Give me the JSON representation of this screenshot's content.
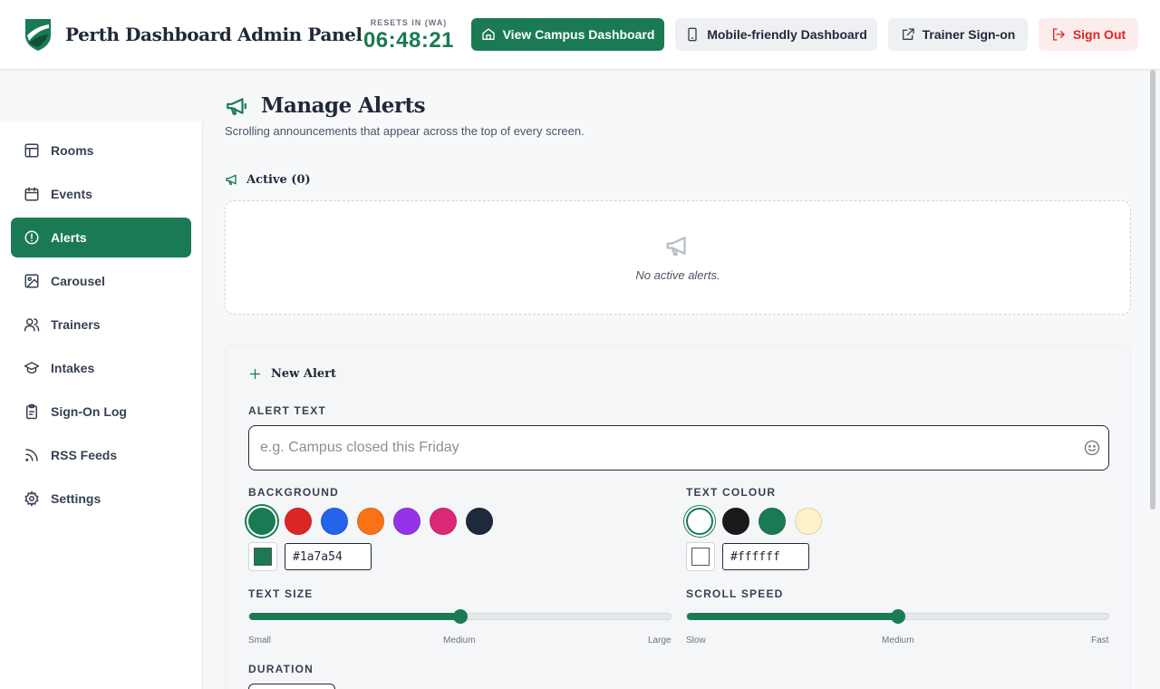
{
  "header": {
    "title": "Perth Dashboard Admin Panel",
    "timer_label": "RESETS IN (WA)",
    "timer_value": "06:48:21",
    "view_campus": "View Campus Dashboard",
    "mobile": "Mobile-friendly Dashboard",
    "trainer": "Trainer Sign-on",
    "signout": "Sign Out"
  },
  "sidebar": {
    "items": [
      {
        "label": "Rooms",
        "icon": "layout-icon"
      },
      {
        "label": "Events",
        "icon": "calendar-icon"
      },
      {
        "label": "Alerts",
        "icon": "alert-circle-icon",
        "active": true
      },
      {
        "label": "Carousel",
        "icon": "image-icon"
      },
      {
        "label": "Trainers",
        "icon": "users-icon"
      },
      {
        "label": "Intakes",
        "icon": "graduation-cap-icon"
      },
      {
        "label": "Sign-On Log",
        "icon": "clipboard-icon"
      },
      {
        "label": "RSS Feeds",
        "icon": "rss-icon"
      },
      {
        "label": "Settings",
        "icon": "gear-icon"
      }
    ]
  },
  "main": {
    "title": "Manage Alerts",
    "subtitle": "Scrolling announcements that appear across the top of every screen.",
    "active_heading": "Active (0)",
    "empty_text": "No active alerts.",
    "new_alert": {
      "heading": "New Alert",
      "alert_text_label": "ALERT TEXT",
      "alert_text_placeholder": "e.g. Campus closed this Friday",
      "alert_text_value": "",
      "background_label": "BACKGROUND",
      "background_swatches": [
        "#1a7a54",
        "#dc2626",
        "#2563eb",
        "#f97316",
        "#9333ea",
        "#db2777",
        "#1e293b"
      ],
      "background_selected": "#1a7a54",
      "background_hex": "#1a7a54",
      "text_colour_label": "TEXT COLOUR",
      "text_swatches": [
        "#ffffff",
        "#1a1a1a",
        "#1a7a54",
        "#fdf2c8"
      ],
      "text_selected": "#ffffff",
      "text_hex": "#ffffff",
      "text_size_label": "TEXT SIZE",
      "text_size_ticks": [
        "Small",
        "Medium",
        "Large"
      ],
      "text_size_value": 0.5,
      "scroll_speed_label": "SCROLL SPEED",
      "scroll_speed_ticks": [
        "Slow",
        "Medium",
        "Fast"
      ],
      "scroll_speed_value": 0.5,
      "duration_label": "DURATION"
    }
  },
  "colors": {
    "accent": "#1a7a54",
    "danger": "#dc2626"
  }
}
